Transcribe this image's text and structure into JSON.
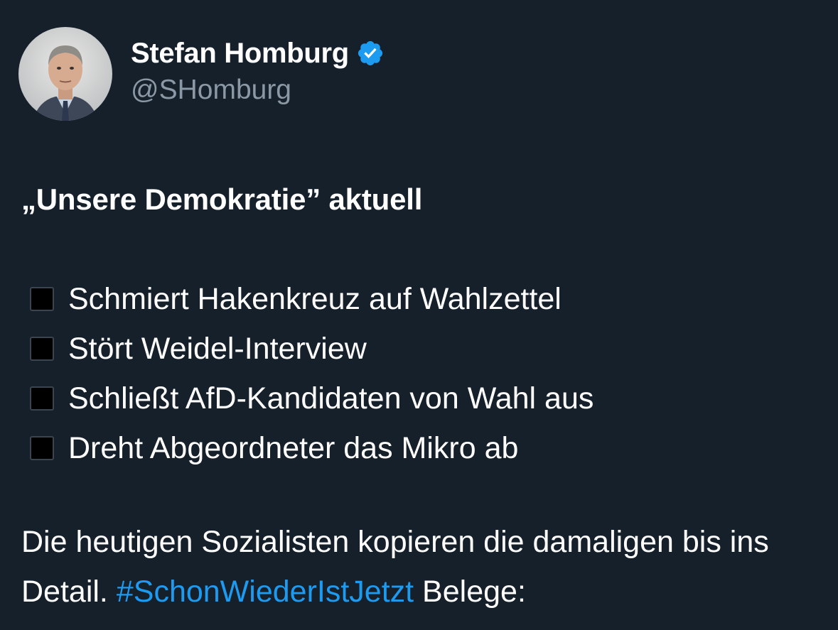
{
  "author": {
    "display_name": "Stefan Homburg",
    "handle": "@SHomburg",
    "verified": true,
    "avatar_icon": "profile-photo",
    "verified_icon": "verified-badge-icon",
    "verified_color": "#1d9bf0"
  },
  "tweet": {
    "headline": "„Unsere Demokratie” aktuell",
    "items": [
      {
        "icon": "black-square-icon",
        "text": "Schmiert Hakenkreuz auf Wahlzettel"
      },
      {
        "icon": "black-square-icon",
        "text": "Stört Weidel-Interview"
      },
      {
        "icon": "black-square-icon",
        "text": "Schließt AfD-Kandidaten von Wahl aus"
      },
      {
        "icon": "black-square-icon",
        "text": "Dreht Abgeordneter das Mikro ab"
      }
    ],
    "closing_text": "Die heutigen Sozialisten kopieren die damaligen bis ins Detail.",
    "hashtag": "#SchonWiederIstJetzt",
    "closing_suffix": "Belege:"
  },
  "colors": {
    "background": "#15202b",
    "text": "#ffffff",
    "secondary_text": "#8b98a5",
    "link": "#1d9bf0"
  }
}
